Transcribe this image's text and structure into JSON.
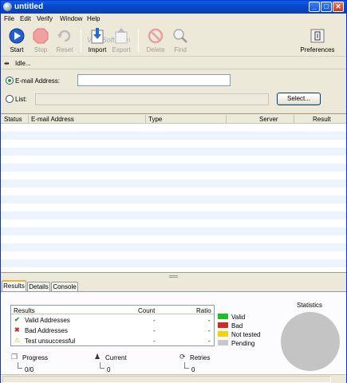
{
  "window": {
    "title": "untitled",
    "minimize": "_",
    "maximize": "□",
    "close": "✕"
  },
  "menu": [
    "File",
    "Edit",
    "Verify",
    "Window",
    "Help"
  ],
  "toolbar": {
    "start": "Start",
    "stop": "Stop",
    "reset": "Reset",
    "import": "Import",
    "export": "Export",
    "delete": "Delete",
    "find": "Find",
    "preferences": "Preferences"
  },
  "watermark": "VeroSoft.com",
  "status": {
    "text": "Idle..."
  },
  "form": {
    "email_label": "E-mail Address:",
    "email_value": "",
    "list_label": "List:",
    "list_value": "",
    "select_button": "Select..."
  },
  "table": {
    "columns": [
      "Status",
      "E-mail Address",
      "Type",
      "Server",
      "Result"
    ]
  },
  "tabs": [
    "Results",
    "Details",
    "Console"
  ],
  "results": {
    "headers": {
      "label": "Results",
      "count": "Count",
      "ratio": "Ratio"
    },
    "rows": [
      {
        "label": "Valid Addresses",
        "count": "-",
        "ratio": "-",
        "icon": "check-icon"
      },
      {
        "label": "Bad Addresses",
        "count": "-",
        "ratio": "-",
        "icon": "cross-icon"
      },
      {
        "label": "Test unsuccessful",
        "count": "-",
        "ratio": "-",
        "icon": "warning-icon"
      }
    ]
  },
  "legend": [
    {
      "label": "Valid",
      "color": "#1fbf1f"
    },
    {
      "label": "Bad",
      "color": "#d42a1f"
    },
    {
      "label": "Not tested",
      "color": "#f5d300"
    },
    {
      "label": "Pending",
      "color": "#c8c8c8"
    }
  ],
  "statistics": {
    "title": "Statistics"
  },
  "footer": {
    "progress_label": "Progress",
    "progress_value": "0/0",
    "current_label": "Current",
    "current_value": "0",
    "retries_label": "Retries",
    "retries_value": "0"
  }
}
